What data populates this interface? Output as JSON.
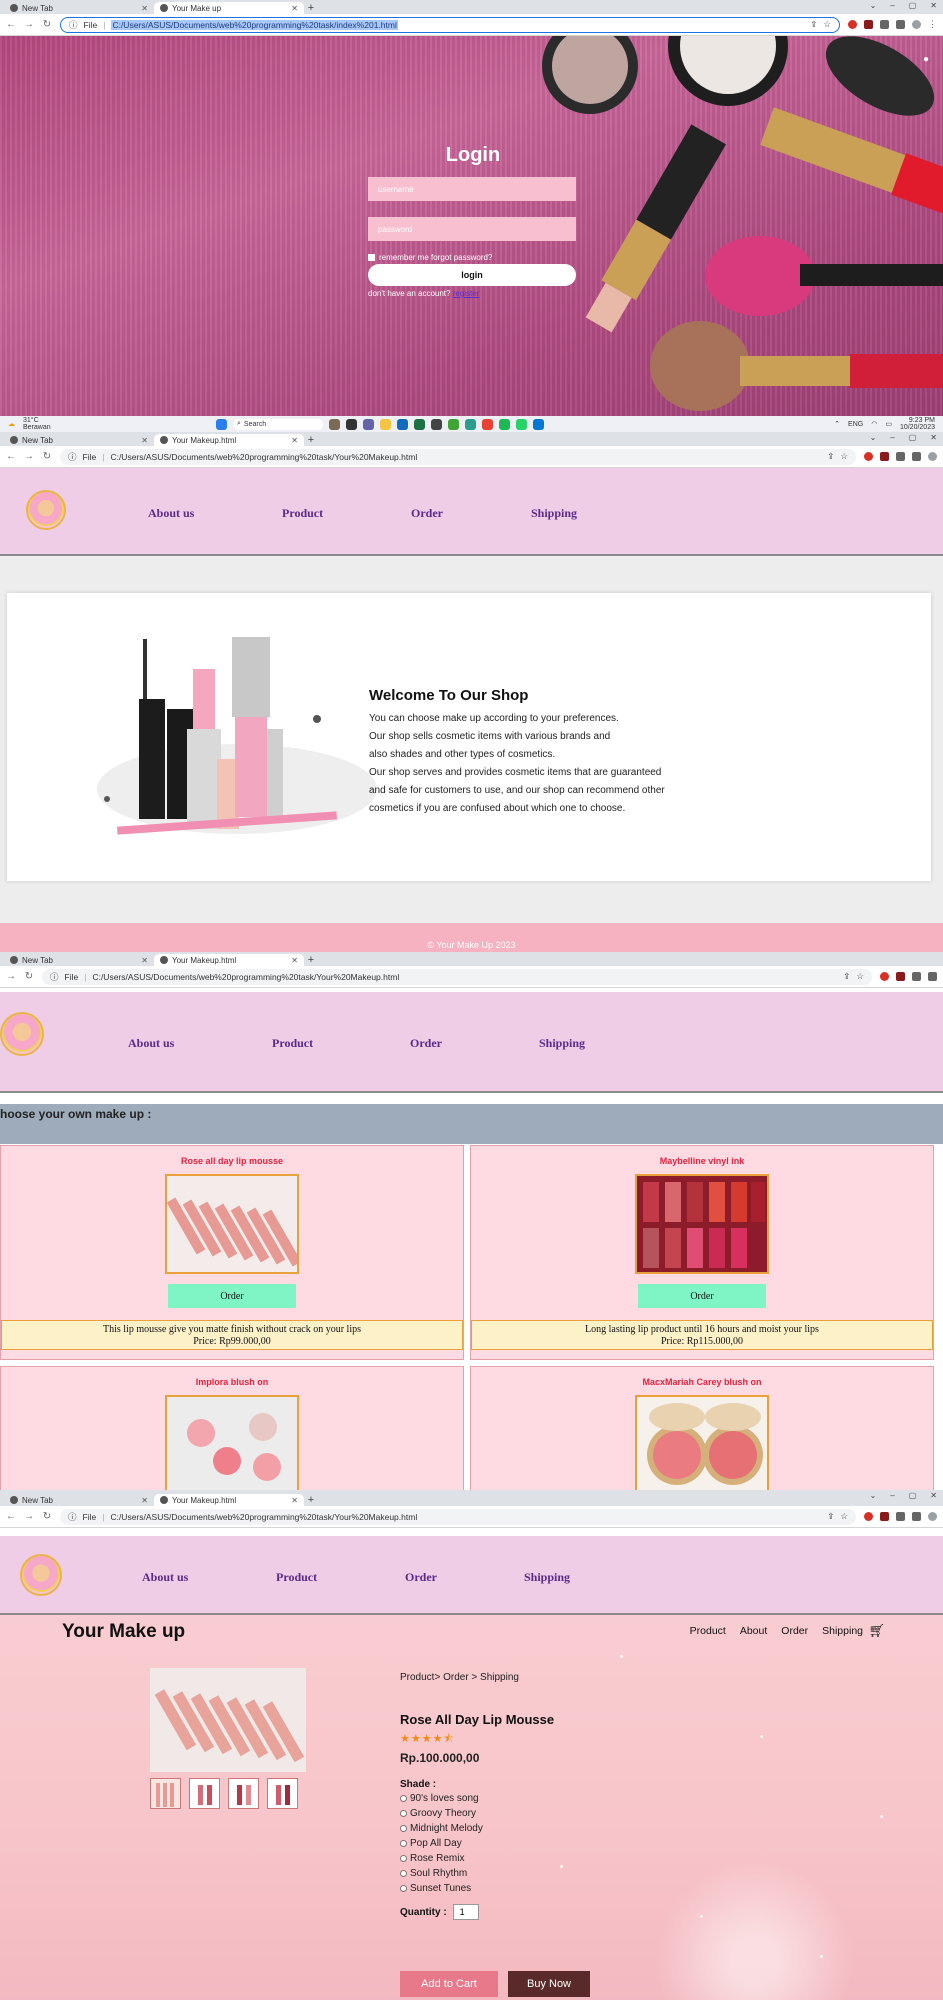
{
  "login_window": {
    "tabs": [
      {
        "label": "New Tab",
        "active": false
      },
      {
        "label": "Your Make up",
        "active": true
      }
    ],
    "file_label": "File",
    "url": "C:/Users/ASUS/Documents/web%20programming%20task/index%201.html",
    "form": {
      "title": "Login",
      "username_placeholder": "username",
      "password_placeholder": "password",
      "remember_text": "remember me forgot password?",
      "login_label": "login",
      "no_account_text": "don't have an account?",
      "register_label": "register"
    },
    "taskbar": {
      "weather_temp": "31°C",
      "weather_desc": "Berawan",
      "search_label": "Search",
      "lang": "ENG",
      "time": "9:23 PM",
      "date": "10/20/2023"
    }
  },
  "site": {
    "tab_label": "Your Makeup.html",
    "newtab_label": "New Tab",
    "file_label": "File",
    "url": "C:/Users/ASUS/Documents/web%20programming%20task/Your%20Makeup.html",
    "nav": [
      "About us",
      "Product",
      "Order",
      "Shipping"
    ]
  },
  "welcome": {
    "title": "Welcome To Our Shop",
    "lines": [
      "You can choose make up according to your preferences.",
      "Our shop sells cosmetic items with various brands and",
      "also shades and other types of cosmetics.",
      "Our shop serves and provides cosmetic items that are guaranteed",
      "and safe for customers to use, and our shop can recommend other",
      "cosmetics if you are confused about which one to choose."
    ],
    "footer": "© Your Make Up 2023"
  },
  "products": {
    "heading": "hoose your own make up :",
    "order_label": "Order",
    "items": [
      {
        "name": "Rose all day lip mousse",
        "desc": "This lip mousse give you matte finish without crack on your lips",
        "price": "Price: Rp99.000,00",
        "img_color": "#e7a6a0"
      },
      {
        "name": "Maybelline vinyl ink",
        "desc": "Long lasting lip product until 16 hours and moist your lips",
        "price": "Price: Rp115.000,00",
        "img_color": "#b8333f"
      },
      {
        "name": "Implora blush on",
        "desc": "",
        "price": "",
        "img_color": "#f18b96"
      },
      {
        "name": "MacxMariah Carey blush on",
        "desc": "",
        "price": "",
        "img_color": "#e5736f"
      }
    ]
  },
  "detail": {
    "brand": "Your Make up",
    "topnav": [
      "Product",
      "About",
      "Order",
      "Shipping"
    ],
    "breadcrumb": "Product> Order > Shipping",
    "product_name": "Rose All Day Lip Mousse",
    "rating": 4.5,
    "price": "Rp.100.000,00",
    "shade_label": "Shade :",
    "shades": [
      "90's loves song",
      "Groovy Theory",
      "Midnight Melody",
      "Pop All Day",
      "Rose Remix",
      "Soul Rhythm",
      "Sunset Tunes"
    ],
    "quantity_label": "Quantity :",
    "quantity": "1",
    "add_to_cart": "Add to Cart",
    "buy_now": "Buy Now"
  }
}
